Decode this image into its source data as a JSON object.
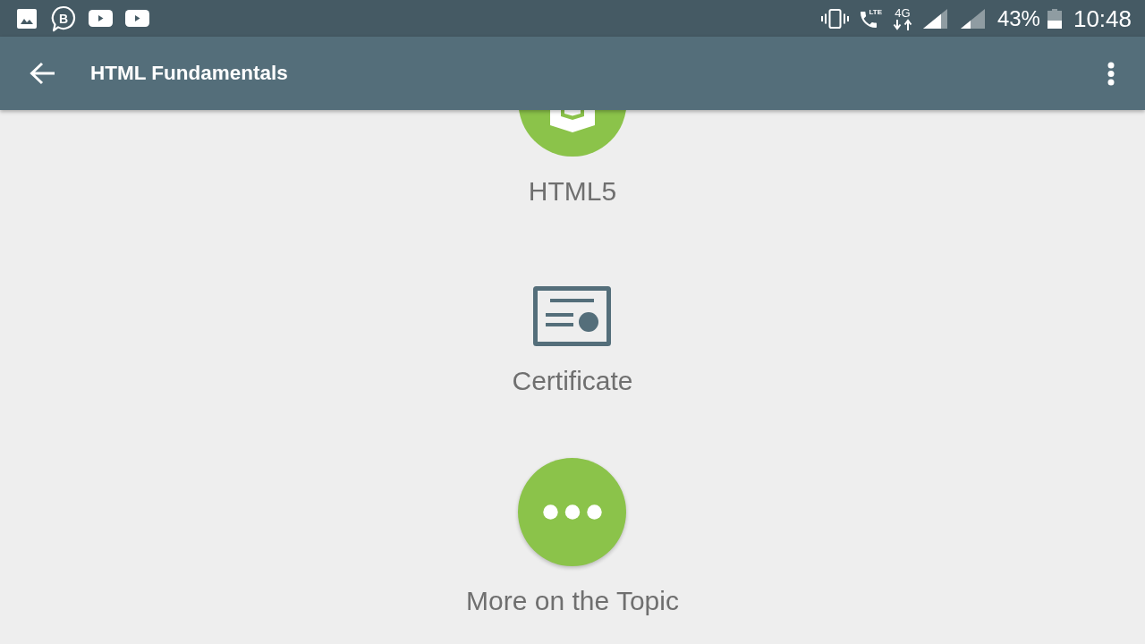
{
  "status_bar": {
    "chat_icon_letter": "B",
    "call_icon_label": "LTE",
    "network_label": "4G",
    "battery_percent": "43%",
    "time": "10:48"
  },
  "app_bar": {
    "title": "HTML Fundamentals"
  },
  "topics": [
    {
      "kind": "html5",
      "label": "HTML5"
    },
    {
      "kind": "certificate",
      "label": "Certificate"
    },
    {
      "kind": "more",
      "label": "More on the Topic"
    }
  ]
}
